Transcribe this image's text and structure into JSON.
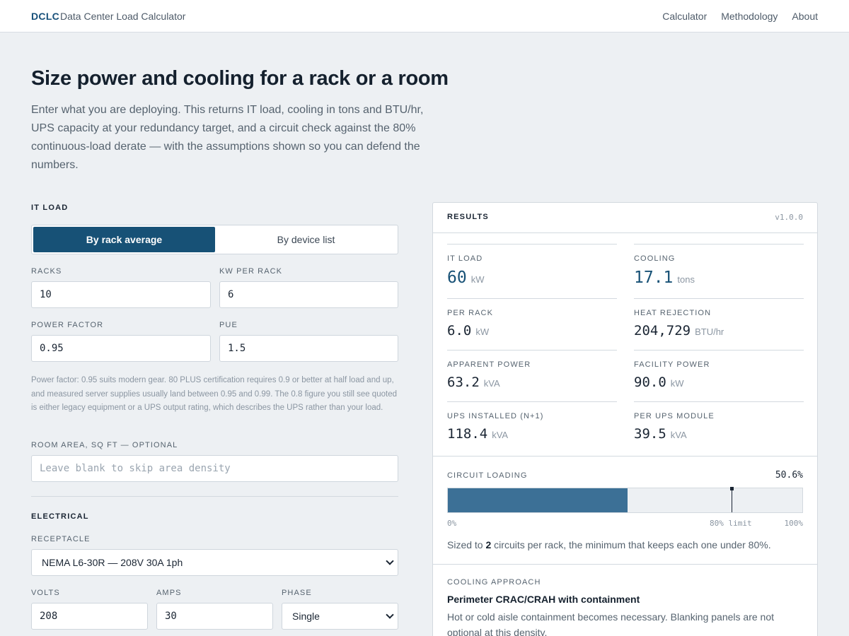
{
  "header": {
    "brand": "DCLC",
    "subtitle": "Data Center Load Calculator",
    "nav": [
      "Calculator",
      "Methodology",
      "About"
    ]
  },
  "hero": {
    "title": "Size power and cooling for a rack or a room",
    "description": "Enter what you are deploying. This returns IT load, cooling in tons and BTU/hr, UPS capacity at your redundancy target, and a circuit check against the 80% continuous-load derate — with the assumptions shown so you can defend the numbers."
  },
  "it_load": {
    "section_label": "IT LOAD",
    "mode_tabs": [
      "By rack average",
      "By device list"
    ],
    "active_mode": "By rack average",
    "racks_label": "RACKS",
    "racks_value": "10",
    "kw_per_rack_label": "KW PER RACK",
    "kw_per_rack_value": "6",
    "power_factor_label": "POWER FACTOR",
    "power_factor_value": "0.95",
    "pue_label": "PUE",
    "pue_value": "1.5",
    "help_text": "Power factor: 0.95 suits modern gear. 80 PLUS certification requires 0.9 or better at half load and up, and measured server supplies usually land between 0.95 and 0.99. The 0.8 figure you still see quoted is either legacy equipment or a UPS output rating, which describes the UPS rather than your load.",
    "room_area_label": "ROOM AREA, SQ FT — OPTIONAL",
    "room_area_placeholder": "Leave blank to skip area density",
    "room_area_value": ""
  },
  "electrical": {
    "section_label": "ELECTRICAL",
    "receptacle_label": "RECEPTACLE",
    "receptacle_value": "NEMA L6-30R — 208V 30A 1ph",
    "volts_label": "VOLTS",
    "volts_value": "208",
    "amps_label": "AMPS",
    "amps_value": "30",
    "phase_label": "PHASE",
    "phase_value": "Single"
  },
  "results": {
    "title": "RESULTS",
    "version": "v1.0.0",
    "metrics": {
      "it_load": {
        "label": "IT LOAD",
        "value": "60",
        "unit": "kW"
      },
      "cooling": {
        "label": "COOLING",
        "value": "17.1",
        "unit": "tons"
      },
      "per_rack": {
        "label": "PER RACK",
        "value": "6.0",
        "unit": "kW"
      },
      "heat_rejection": {
        "label": "HEAT REJECTION",
        "value": "204,729",
        "unit": "BTU/hr"
      },
      "apparent_power": {
        "label": "APPARENT POWER",
        "value": "63.2",
        "unit": "kVA"
      },
      "facility_power": {
        "label": "FACILITY POWER",
        "value": "90.0",
        "unit": "kW"
      },
      "ups_installed": {
        "label": "UPS INSTALLED (N+1)",
        "value": "118.4",
        "unit": "kVA"
      },
      "per_ups_module": {
        "label": "PER UPS MODULE",
        "value": "39.5",
        "unit": "kVA"
      }
    },
    "circuit": {
      "label": "CIRCUIT LOADING",
      "percent_text": "50.6%",
      "loading_percent": 50.6,
      "limit_percent": 80,
      "tick_min": "0%",
      "tick_limit": "80% limit",
      "tick_max": "100%",
      "sizing_prefix": "Sized to",
      "circuits_per_rack": "2",
      "sizing_suffix": "circuits per rack, the minimum that keeps each one under 80%."
    },
    "cooling_approach": {
      "label": "COOLING APPROACH",
      "title": "Perimeter CRAC/CRAH with containment",
      "description": "Hot or cold aisle containment becomes necessary. Blanking panels are not optional at this density."
    }
  },
  "colors": {
    "accent": "#175176",
    "bar_fill": "#3c7096",
    "background": "#edf0f3"
  }
}
